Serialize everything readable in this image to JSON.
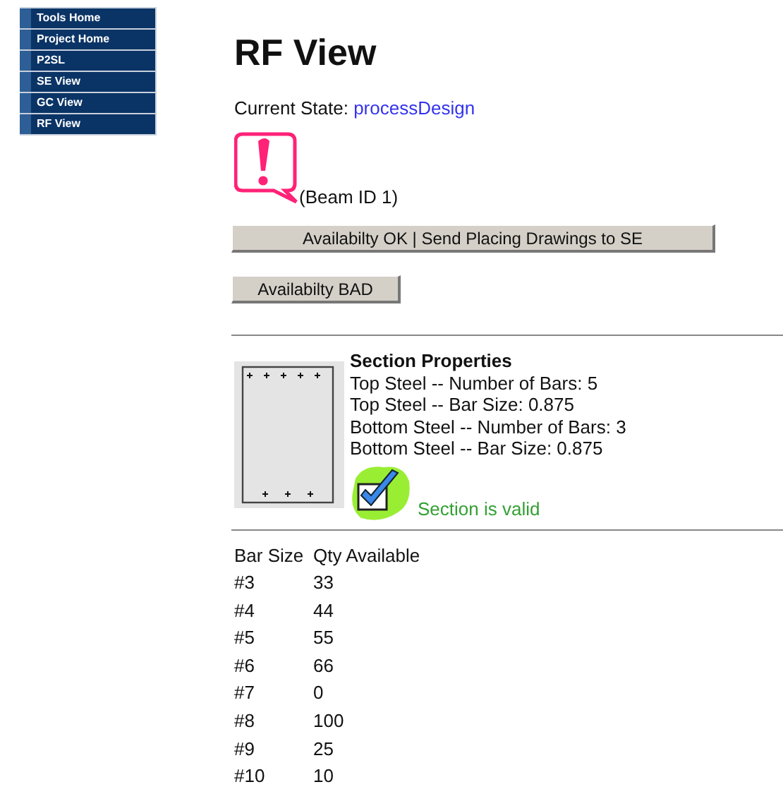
{
  "sidebar": {
    "items": [
      {
        "label": "Tools Home"
      },
      {
        "label": "Project Home"
      },
      {
        "label": "P2SL"
      },
      {
        "label": "SE View"
      },
      {
        "label": "GC View"
      },
      {
        "label": "RF View"
      }
    ]
  },
  "title": "RF View",
  "current_state": {
    "label": "Current State:",
    "value": "processDesign"
  },
  "alert": {
    "text": "(Beam ID 1)"
  },
  "buttons": [
    "Availabilty OK | Send Placing Drawings to SE",
    "Availabilty BAD"
  ],
  "section": {
    "heading": "Section Properties",
    "lines": [
      "Top Steel -- Number of Bars: 5",
      "Top Steel -- Bar Size: 0.875",
      "Bottom Steel -- Number of Bars: 3",
      "Bottom Steel -- Bar Size: 0.875"
    ],
    "status": "Section is valid"
  },
  "bar_table": {
    "columns": [
      "Bar Size",
      "Qty Available"
    ],
    "rows": [
      [
        "#3",
        "33"
      ],
      [
        "#4",
        "44"
      ],
      [
        "#5",
        "55"
      ],
      [
        "#6",
        "66"
      ],
      [
        "#7",
        "0"
      ],
      [
        "#8",
        "100"
      ],
      [
        "#9",
        "25"
      ],
      [
        "#10",
        "10"
      ]
    ]
  }
}
